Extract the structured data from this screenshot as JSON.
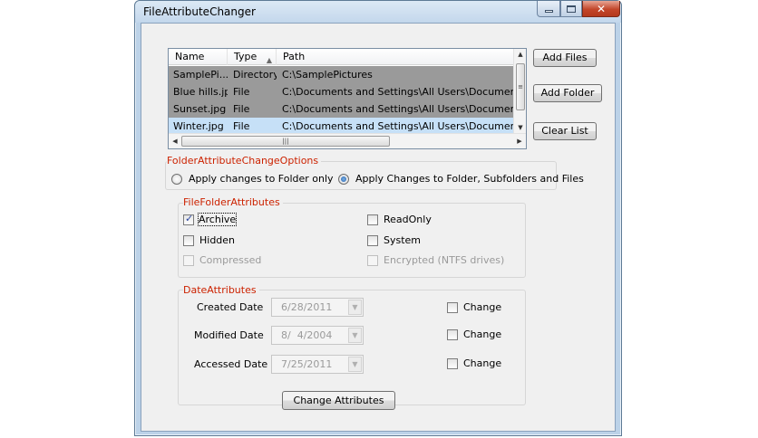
{
  "window": {
    "title": "FileAttributeChanger"
  },
  "list": {
    "columns": {
      "name": "Name",
      "type": "Type",
      "path": "Path"
    },
    "rows": [
      {
        "name": "SamplePi...",
        "type": "Directory",
        "path": "C:\\SamplePictures"
      },
      {
        "name": "Blue hills.jpg",
        "type": "File",
        "path": "C:\\Documents and Settings\\All Users\\Documents\\My"
      },
      {
        "name": "Sunset.jpg",
        "type": "File",
        "path": "C:\\Documents and Settings\\All Users\\Documents\\My"
      },
      {
        "name": "Winter.jpg",
        "type": "File",
        "path": "C:\\Documents and Settings\\All Users\\Documents\\My"
      }
    ],
    "selected_row": "Winter.jpg"
  },
  "buttons": {
    "add_files": "Add Files",
    "add_folder": "Add Folder",
    "clear_list": "Clear List",
    "change_attributes": "Change Attributes"
  },
  "options": {
    "title": "FolderAttributeChangeOptions",
    "folder_only": "Apply changes to Folder only",
    "recursive": "Apply Changes to Folder, Subfolders and Files",
    "selected": "recursive"
  },
  "attributes": {
    "title": "FileFolderAttributes",
    "archive": {
      "label": "Archive",
      "checked": true
    },
    "readonly": {
      "label": "ReadOnly",
      "checked": false
    },
    "hidden": {
      "label": "Hidden",
      "checked": false
    },
    "system": {
      "label": "System",
      "checked": false
    },
    "compressed": {
      "label": "Compressed",
      "checked": false,
      "enabled": false
    },
    "encrypted": {
      "label": "Encrypted (NTFS drives)",
      "checked": false,
      "enabled": false
    }
  },
  "dates": {
    "title": "DateAttributes",
    "created": {
      "label": "Created Date",
      "value": "6/28/2011"
    },
    "modified": {
      "label": "Modified Date",
      "value": "8/  4/2004"
    },
    "accessed": {
      "label": "Accessed Date",
      "value": "7/25/2011"
    },
    "change_label": "Change"
  },
  "colors": {
    "group_title": "#cc2200",
    "selection": "#c6e0f7",
    "row_fill": "#9a9a9a"
  }
}
